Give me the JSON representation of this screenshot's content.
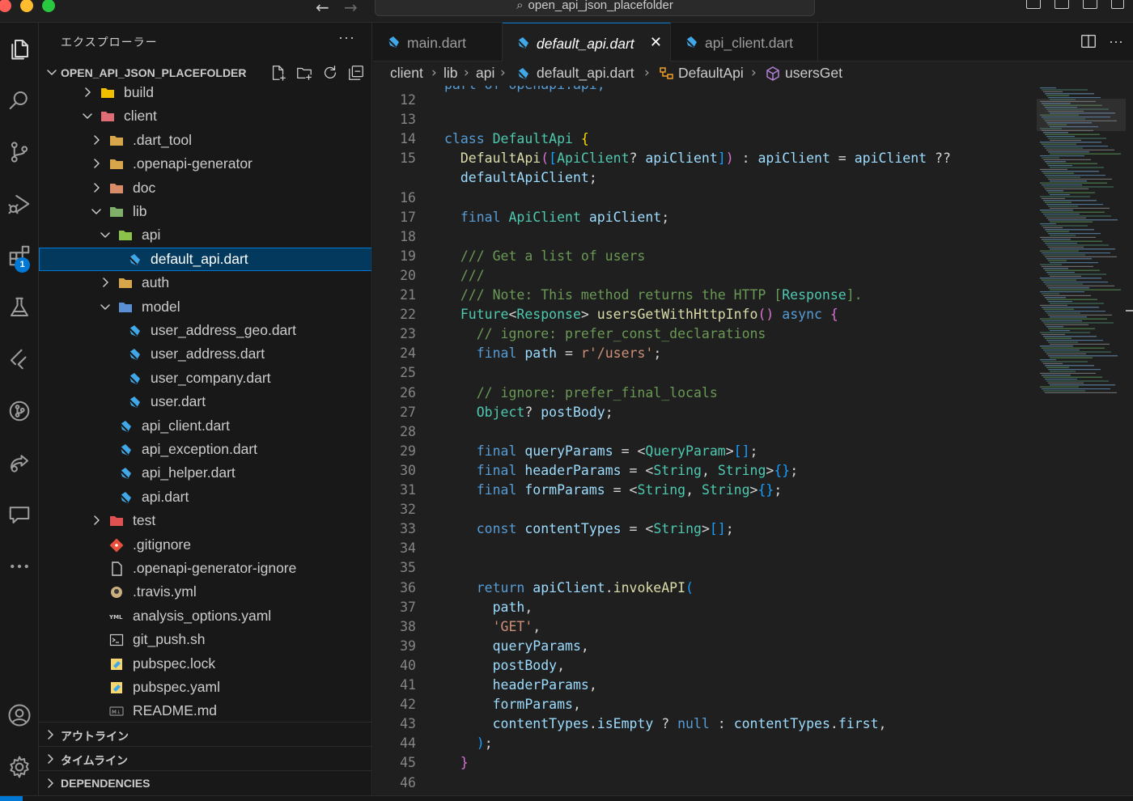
{
  "titlebar": {
    "search_text": "open_api_json_placefolder",
    "back_icon": "arrow-left-icon",
    "forward_icon": "arrow-right-icon"
  },
  "activity_bar": {
    "items": [
      {
        "name": "explorer",
        "icon": "files-icon"
      },
      {
        "name": "search",
        "icon": "search-icon"
      },
      {
        "name": "source-control",
        "icon": "source-control-icon"
      },
      {
        "name": "run-debug",
        "icon": "run-debug-icon"
      },
      {
        "name": "extensions",
        "icon": "extensions-icon",
        "badge": "1"
      },
      {
        "name": "testing",
        "icon": "beaker-icon"
      },
      {
        "name": "flutter",
        "icon": "flutter-icon"
      },
      {
        "name": "git-graph",
        "icon": "git-graph-icon"
      },
      {
        "name": "live-share",
        "icon": "live-share-icon"
      },
      {
        "name": "comments",
        "icon": "comments-icon"
      },
      {
        "name": "more",
        "icon": "ellipsis-icon"
      }
    ],
    "bottom": [
      {
        "name": "accounts",
        "icon": "account-icon"
      },
      {
        "name": "manage",
        "icon": "gear-icon"
      }
    ]
  },
  "sidebar": {
    "title": "エクスプローラー",
    "more": "···",
    "root": "OPEN_API_JSON_PLACEFOLDER",
    "tree": [
      {
        "label": "build",
        "depth": 1,
        "kind": "folder-build",
        "expanded": false
      },
      {
        "label": "client",
        "depth": 1,
        "kind": "folder-client",
        "expanded": true
      },
      {
        "label": ".dart_tool",
        "depth": 2,
        "kind": "folder",
        "expanded": false
      },
      {
        "label": ".openapi-generator",
        "depth": 2,
        "kind": "folder",
        "expanded": false
      },
      {
        "label": "doc",
        "depth": 2,
        "kind": "folder-doc",
        "expanded": false
      },
      {
        "label": "lib",
        "depth": 2,
        "kind": "folder-lib",
        "expanded": true
      },
      {
        "label": "api",
        "depth": 3,
        "kind": "folder-api",
        "expanded": true
      },
      {
        "label": "default_api.dart",
        "depth": 4,
        "kind": "dart",
        "selected": true
      },
      {
        "label": "auth",
        "depth": 3,
        "kind": "folder",
        "expanded": false
      },
      {
        "label": "model",
        "depth": 3,
        "kind": "folder-model",
        "expanded": true
      },
      {
        "label": "user_address_geo.dart",
        "depth": 4,
        "kind": "dart"
      },
      {
        "label": "user_address.dart",
        "depth": 4,
        "kind": "dart"
      },
      {
        "label": "user_company.dart",
        "depth": 4,
        "kind": "dart"
      },
      {
        "label": "user.dart",
        "depth": 4,
        "kind": "dart"
      },
      {
        "label": "api_client.dart",
        "depth": 3,
        "kind": "dart"
      },
      {
        "label": "api_exception.dart",
        "depth": 3,
        "kind": "dart"
      },
      {
        "label": "api_helper.dart",
        "depth": 3,
        "kind": "dart"
      },
      {
        "label": "api.dart",
        "depth": 3,
        "kind": "dart"
      },
      {
        "label": "test",
        "depth": 2,
        "kind": "folder-test",
        "expanded": false
      },
      {
        "label": ".gitignore",
        "depth": 2,
        "kind": "git"
      },
      {
        "label": ".openapi-generator-ignore",
        "depth": 2,
        "kind": "file"
      },
      {
        "label": ".travis.yml",
        "depth": 2,
        "kind": "travis"
      },
      {
        "label": "analysis_options.yaml",
        "depth": 2,
        "kind": "yaml"
      },
      {
        "label": "git_push.sh",
        "depth": 2,
        "kind": "shell"
      },
      {
        "label": "pubspec.lock",
        "depth": 2,
        "kind": "pubspec"
      },
      {
        "label": "pubspec.yaml",
        "depth": 2,
        "kind": "pubspec"
      },
      {
        "label": "README.md",
        "depth": 2,
        "kind": "markdown"
      }
    ],
    "sections": [
      "アウトライン",
      "タイムライン",
      "DEPENDENCIES"
    ]
  },
  "editor": {
    "tabs": [
      {
        "label": "main.dart",
        "active": false
      },
      {
        "label": "default_api.dart",
        "active": true
      },
      {
        "label": "api_client.dart",
        "active": false
      }
    ],
    "breadcrumb": [
      "client",
      "lib",
      "api",
      "default_api.dart",
      "DefaultApi",
      "usersGet"
    ],
    "partial_top_line": "part of openapi.api;",
    "lines": [
      {
        "n": "12",
        "code": []
      },
      {
        "n": "13",
        "code": []
      },
      {
        "n": "14",
        "code": [
          [
            "kw",
            "class "
          ],
          [
            "ty",
            "DefaultApi "
          ],
          [
            "br1",
            "{"
          ]
        ]
      },
      {
        "n": "15",
        "code": [
          [
            "pl",
            "  "
          ],
          [
            "fn",
            "DefaultApi"
          ],
          [
            "br2",
            "("
          ],
          [
            "br3",
            "["
          ],
          [
            "ty",
            "ApiClient"
          ],
          [
            "pl",
            "? "
          ],
          [
            "vr",
            "apiClient"
          ],
          [
            "br3",
            "]"
          ],
          [
            "br2",
            ")"
          ],
          [
            "pl",
            " : "
          ],
          [
            "vr",
            "apiClient"
          ],
          [
            "pl",
            " = "
          ],
          [
            "vr",
            "apiClient"
          ],
          [
            "pl",
            " ??"
          ]
        ]
      },
      {
        "n": "",
        "code": [
          [
            "pl",
            "  "
          ],
          [
            "vr",
            "defaultApiClient"
          ],
          [
            "pl",
            ";"
          ]
        ]
      },
      {
        "n": "16",
        "code": []
      },
      {
        "n": "17",
        "code": [
          [
            "pl",
            "  "
          ],
          [
            "kw",
            "final "
          ],
          [
            "ty",
            "ApiClient "
          ],
          [
            "vr",
            "apiClient"
          ],
          [
            "pl",
            ";"
          ]
        ]
      },
      {
        "n": "18",
        "code": []
      },
      {
        "n": "19",
        "code": [
          [
            "pl",
            "  "
          ],
          [
            "cm",
            "/// Get a list of users"
          ]
        ]
      },
      {
        "n": "20",
        "code": [
          [
            "pl",
            "  "
          ],
          [
            "cm",
            "///"
          ]
        ]
      },
      {
        "n": "21",
        "code": [
          [
            "pl",
            "  "
          ],
          [
            "cm",
            "/// Note: This method returns the HTTP ["
          ],
          [
            "ty",
            "Response"
          ],
          [
            "cm",
            "]."
          ]
        ]
      },
      {
        "n": "22",
        "code": [
          [
            "pl",
            "  "
          ],
          [
            "ty",
            "Future"
          ],
          [
            "pl",
            "<"
          ],
          [
            "ty",
            "Response"
          ],
          [
            "pl",
            "> "
          ],
          [
            "fn",
            "usersGetWithHttpInfo"
          ],
          [
            "br2",
            "()"
          ],
          [
            "pl",
            " "
          ],
          [
            "kw",
            "async "
          ],
          [
            "br2",
            "{"
          ]
        ]
      },
      {
        "n": "23",
        "code": [
          [
            "pl",
            "    "
          ],
          [
            "cm",
            "// ignore: prefer_const_declarations"
          ]
        ]
      },
      {
        "n": "24",
        "code": [
          [
            "pl",
            "    "
          ],
          [
            "kw",
            "final "
          ],
          [
            "vr",
            "path"
          ],
          [
            "pl",
            " = "
          ],
          [
            "st",
            "r'/users'"
          ],
          [
            "pl",
            ";"
          ]
        ]
      },
      {
        "n": "25",
        "code": []
      },
      {
        "n": "26",
        "code": [
          [
            "pl",
            "    "
          ],
          [
            "cm",
            "// ignore: prefer_final_locals"
          ]
        ]
      },
      {
        "n": "27",
        "code": [
          [
            "pl",
            "    "
          ],
          [
            "ty",
            "Object"
          ],
          [
            "pl",
            "? "
          ],
          [
            "vr",
            "postBody"
          ],
          [
            "pl",
            ";"
          ]
        ]
      },
      {
        "n": "28",
        "code": []
      },
      {
        "n": "29",
        "code": [
          [
            "pl",
            "    "
          ],
          [
            "kw",
            "final "
          ],
          [
            "vr",
            "queryParams"
          ],
          [
            "pl",
            " = <"
          ],
          [
            "ty",
            "QueryParam"
          ],
          [
            "pl",
            ">"
          ],
          [
            "br3",
            "[]"
          ],
          [
            "pl",
            ";"
          ]
        ]
      },
      {
        "n": "30",
        "code": [
          [
            "pl",
            "    "
          ],
          [
            "kw",
            "final "
          ],
          [
            "vr",
            "headerParams"
          ],
          [
            "pl",
            " = <"
          ],
          [
            "ty",
            "String"
          ],
          [
            "pl",
            ", "
          ],
          [
            "ty",
            "String"
          ],
          [
            "pl",
            ">"
          ],
          [
            "br3",
            "{}"
          ],
          [
            "pl",
            ";"
          ]
        ]
      },
      {
        "n": "31",
        "code": [
          [
            "pl",
            "    "
          ],
          [
            "kw",
            "final "
          ],
          [
            "vr",
            "formParams"
          ],
          [
            "pl",
            " = <"
          ],
          [
            "ty",
            "String"
          ],
          [
            "pl",
            ", "
          ],
          [
            "ty",
            "String"
          ],
          [
            "pl",
            ">"
          ],
          [
            "br3",
            "{}"
          ],
          [
            "pl",
            ";"
          ]
        ]
      },
      {
        "n": "32",
        "code": []
      },
      {
        "n": "33",
        "code": [
          [
            "pl",
            "    "
          ],
          [
            "kw",
            "const "
          ],
          [
            "vr",
            "contentTypes"
          ],
          [
            "pl",
            " = <"
          ],
          [
            "ty",
            "String"
          ],
          [
            "pl",
            ">"
          ],
          [
            "br3",
            "[]"
          ],
          [
            "pl",
            ";"
          ]
        ]
      },
      {
        "n": "34",
        "code": []
      },
      {
        "n": "35",
        "code": []
      },
      {
        "n": "36",
        "code": [
          [
            "pl",
            "    "
          ],
          [
            "kw",
            "return "
          ],
          [
            "vr",
            "apiClient"
          ],
          [
            "pl",
            "."
          ],
          [
            "fn",
            "invokeAPI"
          ],
          [
            "br3",
            "("
          ]
        ]
      },
      {
        "n": "37",
        "code": [
          [
            "pl",
            "      "
          ],
          [
            "vr",
            "path"
          ],
          [
            "pl",
            ","
          ]
        ]
      },
      {
        "n": "38",
        "code": [
          [
            "pl",
            "      "
          ],
          [
            "st",
            "'GET'"
          ],
          [
            "pl",
            ","
          ]
        ]
      },
      {
        "n": "39",
        "code": [
          [
            "pl",
            "      "
          ],
          [
            "vr",
            "queryParams"
          ],
          [
            "pl",
            ","
          ]
        ]
      },
      {
        "n": "40",
        "code": [
          [
            "pl",
            "      "
          ],
          [
            "vr",
            "postBody"
          ],
          [
            "pl",
            ","
          ]
        ]
      },
      {
        "n": "41",
        "code": [
          [
            "pl",
            "      "
          ],
          [
            "vr",
            "headerParams"
          ],
          [
            "pl",
            ","
          ]
        ]
      },
      {
        "n": "42",
        "code": [
          [
            "pl",
            "      "
          ],
          [
            "vr",
            "formParams"
          ],
          [
            "pl",
            ","
          ]
        ]
      },
      {
        "n": "43",
        "code": [
          [
            "pl",
            "      "
          ],
          [
            "vr",
            "contentTypes"
          ],
          [
            "pl",
            "."
          ],
          [
            "vr",
            "isEmpty"
          ],
          [
            "pl",
            " ? "
          ],
          [
            "kw",
            "null"
          ],
          [
            "pl",
            " : "
          ],
          [
            "vr",
            "contentTypes"
          ],
          [
            "pl",
            "."
          ],
          [
            "vr",
            "first"
          ],
          [
            "pl",
            ","
          ]
        ]
      },
      {
        "n": "44",
        "code": [
          [
            "pl",
            "    "
          ],
          [
            "br3",
            ")"
          ],
          [
            "pl",
            ";"
          ]
        ]
      },
      {
        "n": "45",
        "code": [
          [
            "pl",
            "  "
          ],
          [
            "br2",
            "}"
          ]
        ]
      },
      {
        "n": "46",
        "code": []
      }
    ]
  },
  "colors": {
    "accent": "#0078d4",
    "selection": "#04395e",
    "dart": "#40a8e8",
    "folder": "#c09553"
  }
}
